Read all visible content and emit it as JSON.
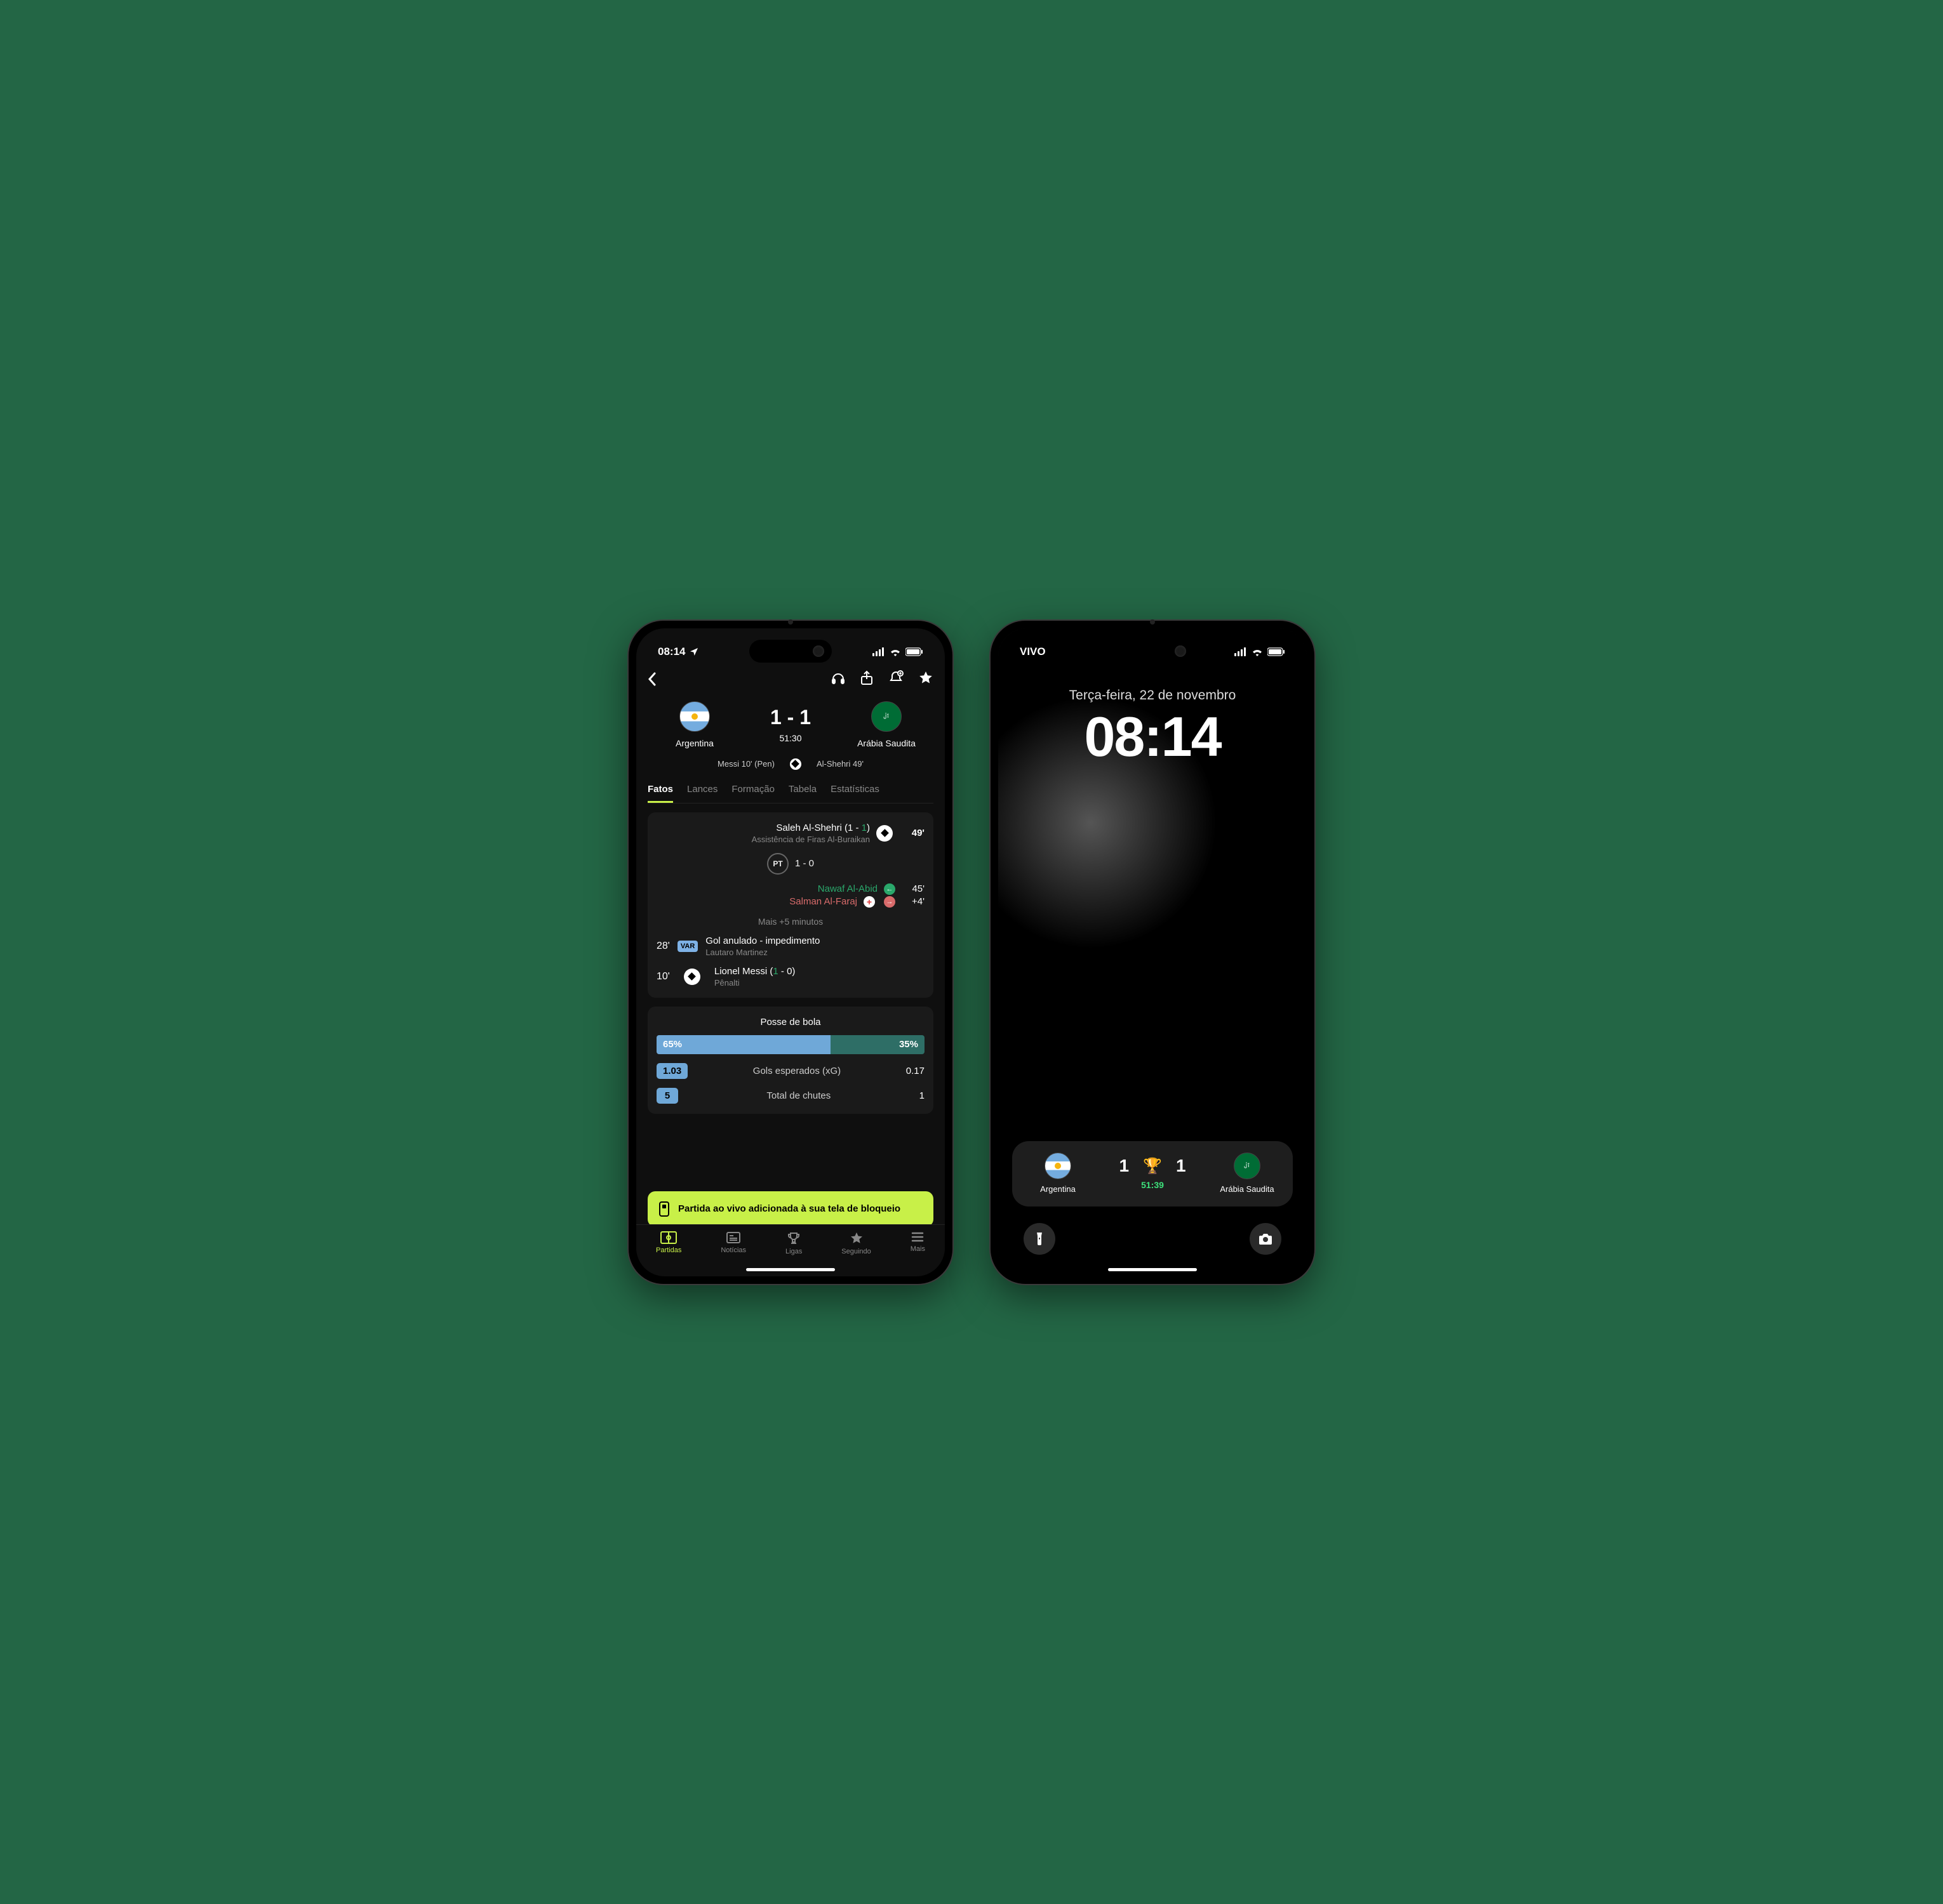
{
  "phone1": {
    "status": {
      "time": "08:14",
      "carrier_icon": "location"
    },
    "scoreboard": {
      "home": {
        "name": "Argentina"
      },
      "away": {
        "name": "Arábia Saudita"
      },
      "score": "1 - 1",
      "match_minute": "51:30",
      "scorers_home": "Messi 10' (Pen)",
      "scorers_away": "Al-Shehri 49'"
    },
    "tabs": [
      "Fatos",
      "Lances",
      "Formação",
      "Tabela",
      "Estatísticas"
    ],
    "events": {
      "goal_away": {
        "player": "Saleh Al-Shehri (1 - 1)",
        "score_part": "1",
        "assist": "Assistência de Firas Al-Buraikan",
        "minute": "49'"
      },
      "pt_label": "PT",
      "pt_score": "1 - 0",
      "sub": {
        "in": "Nawaf Al-Abid",
        "out": "Salman Al-Faraj",
        "min_in": "45'",
        "min_out": "+4'"
      },
      "extra": "Mais +5 minutos",
      "var": {
        "minute": "28'",
        "badge": "VAR",
        "title": "Gol anulado - impedimento",
        "player": "Lautaro Martinez"
      },
      "goal_home": {
        "minute": "10'",
        "player": "Lionel Messi (1 - 0)",
        "score_part": "1",
        "detail": "Pênalti"
      }
    },
    "stats": {
      "possession_title": "Posse de bola",
      "possession_home": "65%",
      "possession_away": "35%",
      "xg_label": "Gols esperados (xG)",
      "xg_home": "1.03",
      "xg_away": "0.17",
      "shots_label": "Total de chutes",
      "shots_home": "5",
      "shots_away": "1"
    },
    "toast": "Partida ao vivo adicionada à sua tela de bloqueio",
    "tabbar": {
      "items": [
        "Partidas",
        "Notícias",
        "Ligas",
        "Seguindo",
        "Mais"
      ]
    }
  },
  "phone2": {
    "status": {
      "carrier": "VIVO"
    },
    "lock": {
      "date": "Terça-feira, 22 de novembro",
      "time": "08:14"
    },
    "live_activity": {
      "home": "Argentina",
      "away": "Arábia Saudita",
      "home_score": "1",
      "away_score": "1",
      "match_minute": "51:39"
    }
  },
  "chart_data": {
    "type": "bar",
    "title": "Posse de bola",
    "categories": [
      "Argentina",
      "Arábia Saudita"
    ],
    "values": [
      65,
      35
    ],
    "unit": "%"
  }
}
